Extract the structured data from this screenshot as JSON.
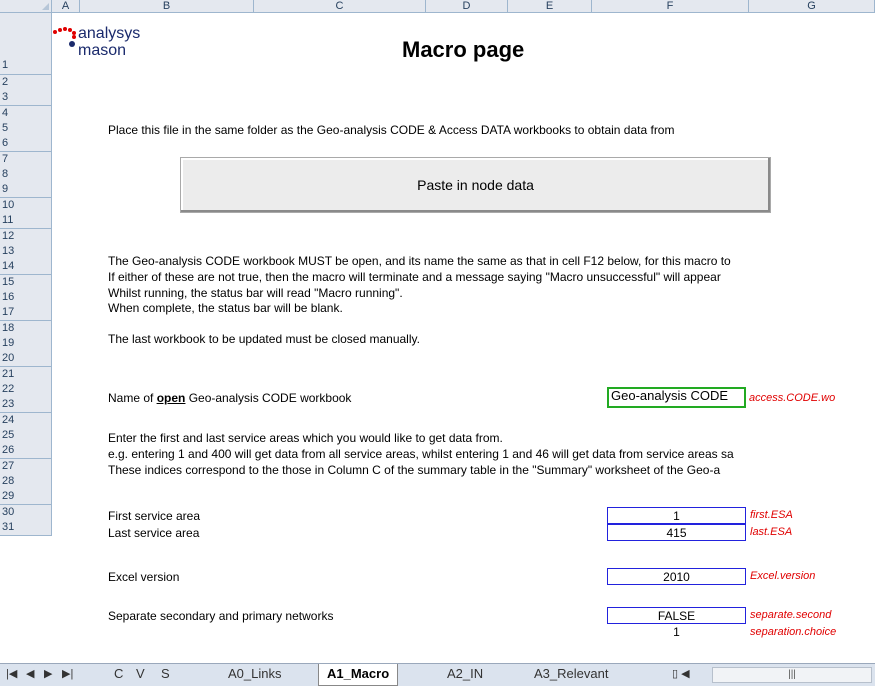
{
  "columns": [
    "A",
    "B",
    "C",
    "D",
    "E",
    "F",
    "G"
  ],
  "rows": [
    "1",
    "2",
    "3",
    "4",
    "5",
    "6",
    "7",
    "8",
    "9",
    "10",
    "11",
    "12",
    "13",
    "14",
    "15",
    "16",
    "17",
    "18",
    "19",
    "20",
    "21",
    "22",
    "23",
    "24",
    "25",
    "26",
    "27",
    "28",
    "29",
    "30",
    "31"
  ],
  "logo": {
    "line1": "analysys",
    "line2": "mason"
  },
  "title": "Macro page",
  "instruction": "Place this file in the same folder as the Geo-analysis CODE & Access DATA workbooks to obtain data from",
  "button_label": "Paste in node data",
  "notes": [
    "The Geo-analysis CODE workbook MUST be open, and its name the same as that in cell F12 below, for this macro to",
    "If either of these are not true, then the macro will terminate and a message saying \"Macro unsuccessful\" will appear",
    "Whilst running, the status bar will read \"Macro running\".",
    "When complete, the status bar will be blank."
  ],
  "note_last": "The last workbook to be updated must be closed manually.",
  "name_label": {
    "pre": "Name of ",
    "bold": "open",
    "post": " Geo-analysis CODE workbook"
  },
  "name_value": "Geo-analysis CODE",
  "name_note": "access.CODE.wo",
  "enter_lines": [
    "Enter the first and last service areas which you would like to get data from.",
    "e.g. entering 1 and 400 will get data from all service areas, whilst entering 1 and 46 will get data from service areas sa",
    "These indices correspond to the those in Column C of the summary table in the \"Summary\" worksheet of the Geo-a"
  ],
  "first_label": "First service area",
  "first_value": "1",
  "first_note": "first.ESA",
  "last_label": "Last service area",
  "last_value": "415",
  "last_note": "last.ESA",
  "excel_label": "Excel version",
  "excel_value": "2010",
  "excel_note": "Excel.version",
  "separate_label": "Separate secondary and primary networks",
  "separate_value": "FALSE",
  "separate_note": "separate.second",
  "choice_value": "1",
  "choice_note": "separation.choice",
  "tabs": [
    "C",
    "V",
    "S",
    "A0_Links",
    "A1_Macro",
    "A2_IN",
    "A3_Relevant"
  ],
  "active_tab": "A1_Macro",
  "colors": {
    "accent_red": "#e00000",
    "header_bg": "#e4e8ef",
    "input_border": "#2222dd",
    "selected_border": "#22aa22"
  }
}
